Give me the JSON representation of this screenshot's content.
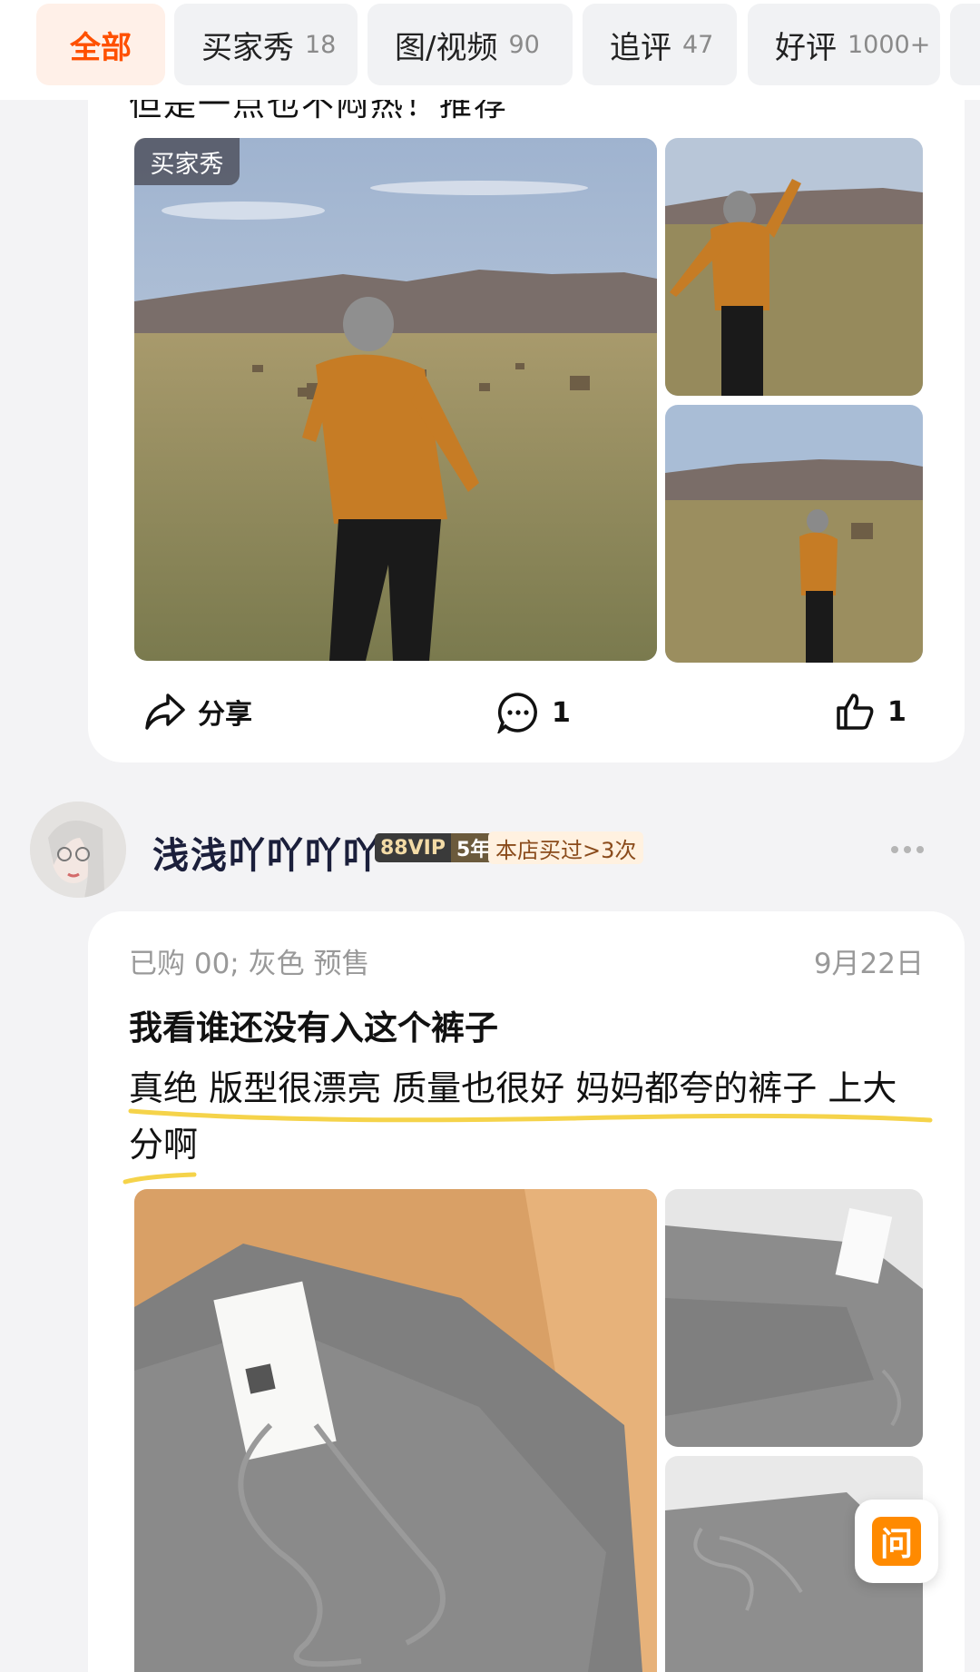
{
  "tabs": [
    {
      "label": "全部",
      "count": ""
    },
    {
      "label": "买家秀",
      "count": "18"
    },
    {
      "label": "图/视频",
      "count": "90"
    },
    {
      "label": "追评",
      "count": "47"
    },
    {
      "label": "好评",
      "count": "1000+"
    }
  ],
  "review1": {
    "cut_text": "但是一点也不闷热！推荐",
    "buyer_tag": "买家秀",
    "actions": {
      "share_label": "分享",
      "comment_count": "1",
      "like_count": "1"
    }
  },
  "review2": {
    "user": {
      "name": "浅浅吖吖吖吖",
      "vip_label": "88VIP",
      "vip_years": "5年",
      "bought_badge": "本店买过>3次"
    },
    "meta": "已购 00; 灰色 预售",
    "date": "9月22日",
    "title": "我看谁还没有入这个裤子",
    "body": "真绝 版型很漂亮 质量也很好 妈妈都夸的裤子 上大分啊"
  },
  "ask_button": {
    "label": "问"
  },
  "colors": {
    "accent": "#ff5000",
    "ask": "#ff8a00",
    "underline": "#f5d34a"
  }
}
